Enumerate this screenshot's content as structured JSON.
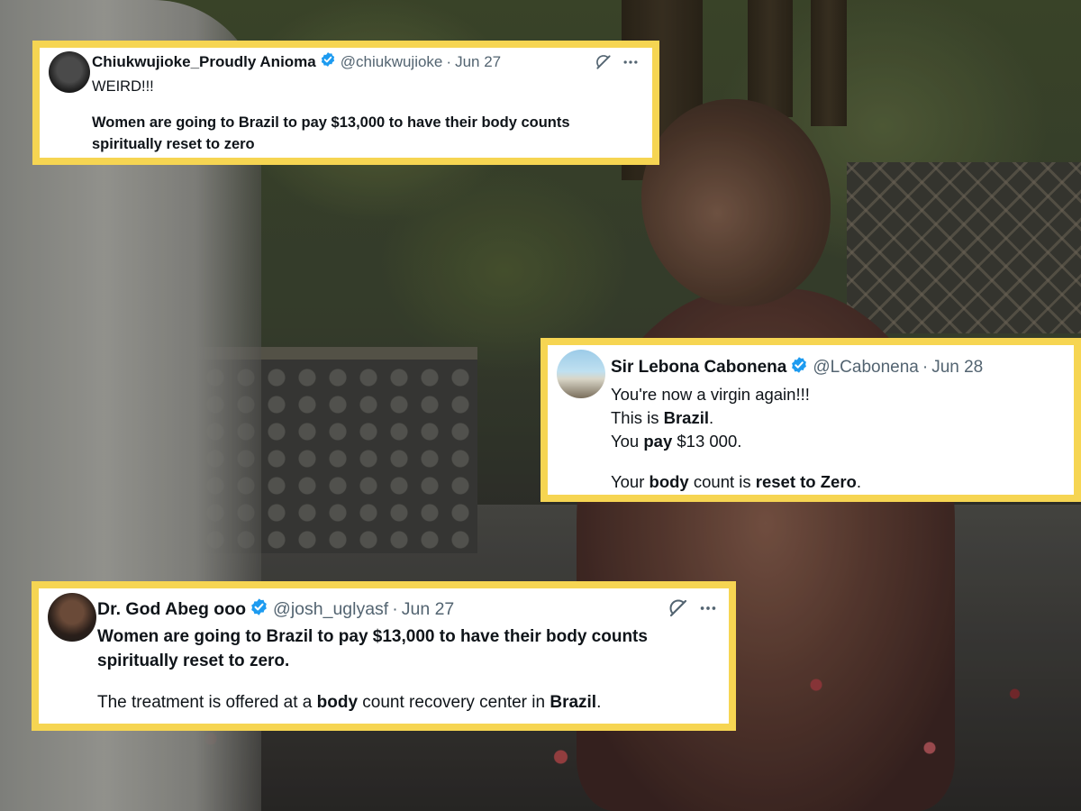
{
  "tweets": [
    {
      "name": "Chiukwujioke_Proudly Anioma",
      "handle": "@chiukwujioke",
      "date": "Jun 27",
      "verified": true,
      "lines": [
        {
          "segments": [
            {
              "text": "WEIRD!!!",
              "bold": false
            }
          ]
        },
        {
          "segments": []
        },
        {
          "segments": [
            {
              "text": "Women are going to Brazil to pay $13,000 to have their body counts",
              "bold": true
            }
          ]
        },
        {
          "segments": [
            {
              "text": "spiritually reset to zero",
              "bold": true
            }
          ]
        }
      ]
    },
    {
      "name": "Sir Lebona Cabonena",
      "handle": "@LCabonena",
      "date": "Jun 28",
      "verified": true,
      "lines": [
        {
          "segments": [
            {
              "text": "You're now a virgin again!!!",
              "bold": false
            }
          ]
        },
        {
          "segments": [
            {
              "text": "This is ",
              "bold": false
            },
            {
              "text": "Brazil",
              "bold": true
            },
            {
              "text": ".",
              "bold": false
            }
          ]
        },
        {
          "segments": [
            {
              "text": "You ",
              "bold": false
            },
            {
              "text": "pay",
              "bold": true
            },
            {
              "text": " $13 000.",
              "bold": false
            }
          ]
        },
        {
          "segments": []
        },
        {
          "segments": [
            {
              "text": "Your ",
              "bold": false
            },
            {
              "text": "body",
              "bold": true
            },
            {
              "text": " count is ",
              "bold": false
            },
            {
              "text": "reset to Zero",
              "bold": true
            },
            {
              "text": ".",
              "bold": false
            }
          ]
        }
      ]
    },
    {
      "name": "Dr. God Abeg ooo",
      "handle": "@josh_uglyasf",
      "date": "Jun 27",
      "verified": true,
      "lines": [
        {
          "segments": [
            {
              "text": "Women are going to Brazil to pay $13,000 to have their body counts",
              "bold": true
            }
          ]
        },
        {
          "segments": [
            {
              "text": "spiritually reset to zero.",
              "bold": true
            }
          ]
        },
        {
          "segments": []
        },
        {
          "segments": [
            {
              "text": "The treatment is offered at a ",
              "bold": false
            },
            {
              "text": "body",
              "bold": true
            },
            {
              "text": " count recovery center in ",
              "bold": false
            },
            {
              "text": "Brazil",
              "bold": true
            },
            {
              "text": ".",
              "bold": false
            }
          ]
        }
      ]
    }
  ],
  "separator": "·",
  "icons": {
    "verified": "verified-badge-icon",
    "grok": "grok-icon",
    "more": "more-icon"
  },
  "colors": {
    "card_border": "#f6d552",
    "verified_blue": "#1d9bf0",
    "secondary_text": "#536471",
    "primary_text": "#0f1419"
  }
}
